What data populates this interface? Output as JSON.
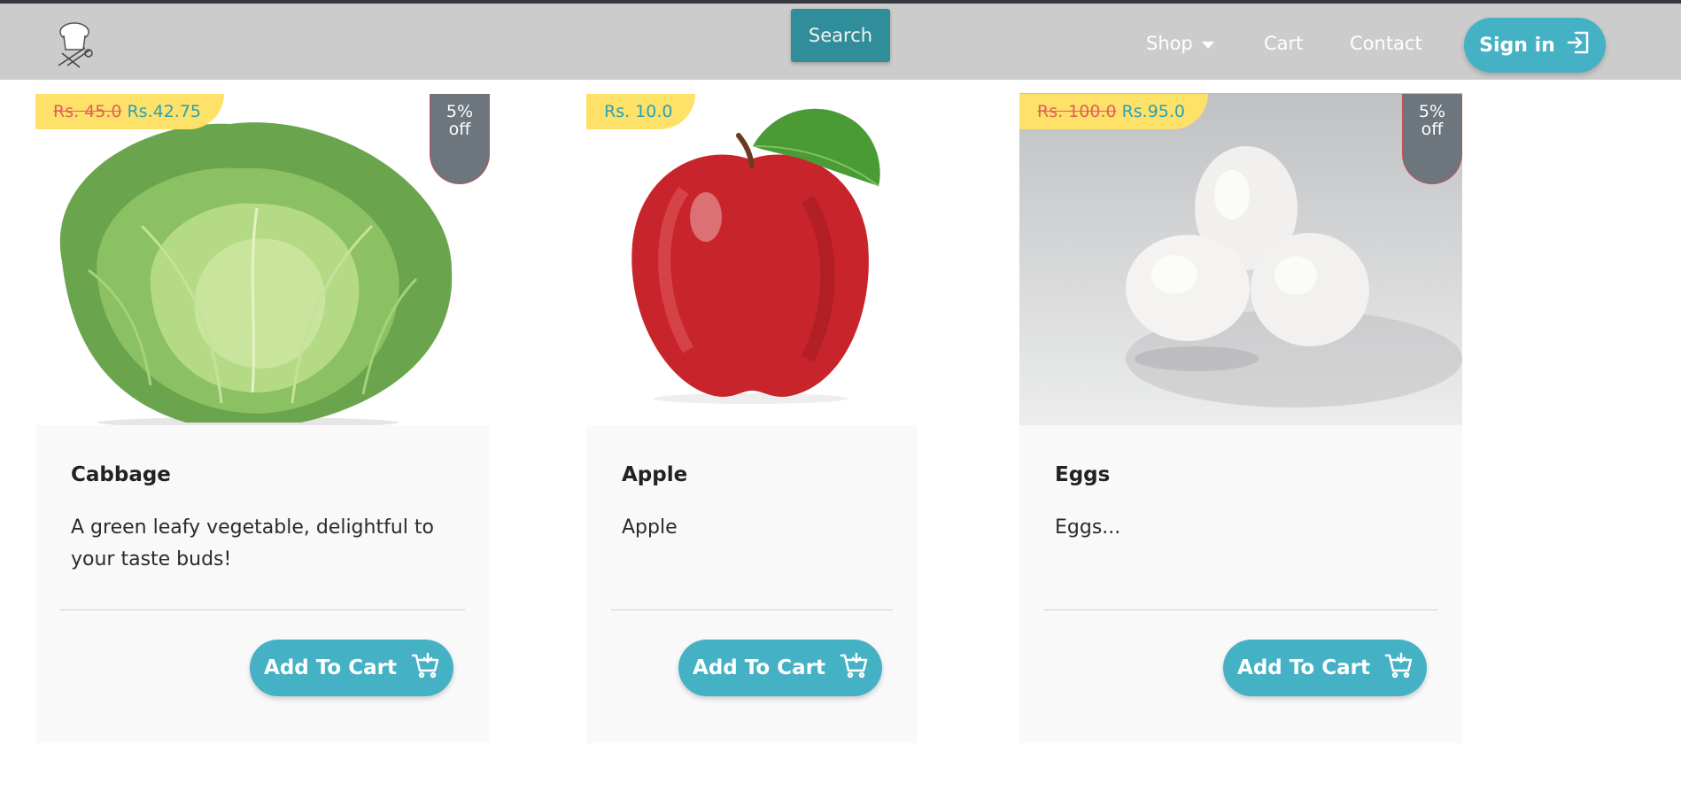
{
  "nav": {
    "search_label": "Search",
    "shop_label": "Shop",
    "cart_label": "Cart",
    "contact_label": "Contact",
    "signin_label": "Sign in"
  },
  "colors": {
    "navbar_bg": "#cccccc",
    "accent": "#45b1c4",
    "search_bg": "#2f8e99",
    "price_tag_bg": "#fde168",
    "discount_bg": "#6d757d"
  },
  "products": [
    {
      "name": "Cabbage",
      "price_old": "Rs. 45.0",
      "price_new": "Rs.42.75",
      "discount_line1": "5%",
      "discount_line2": "off",
      "description": "A green leafy vegetable, delightful to your taste buds!",
      "button_label": "Add To Cart"
    },
    {
      "name": "Apple",
      "price_old": "",
      "price_new": "Rs. 10.0",
      "description": "Apple",
      "button_label": "Add To Cart"
    },
    {
      "name": "Eggs",
      "price_old": "Rs. 100.0",
      "price_new": "Rs.95.0",
      "discount_line1": "5%",
      "discount_line2": "off",
      "description": "Eggs...",
      "button_label": "Add To Cart"
    }
  ]
}
